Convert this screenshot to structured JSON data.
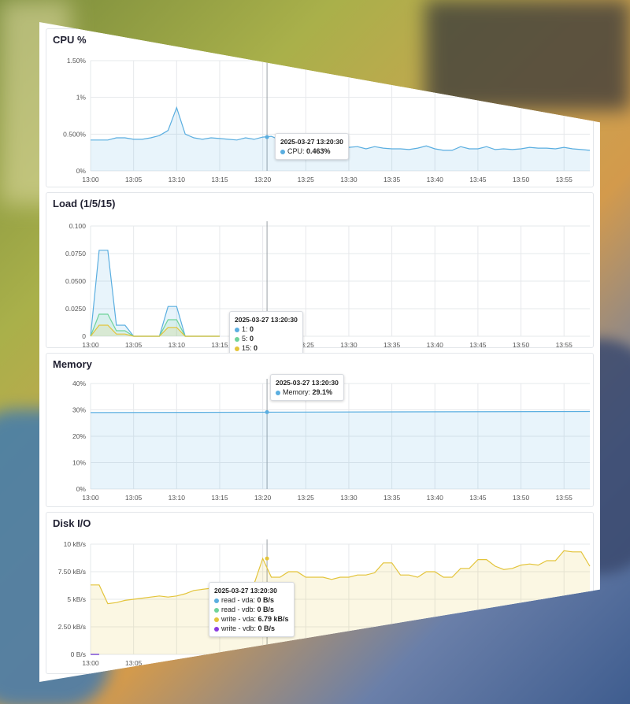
{
  "colors": {
    "cpu": "#5aaee0",
    "cpu_fill": "#dff0fb",
    "load1": "#5aaee0",
    "load5": "#6fd39a",
    "load15": "#e3c43a",
    "memory": "#5aaee0",
    "read_vda": "#5aaee0",
    "read_vdb": "#6fd39a",
    "write_vda": "#e3c43a",
    "write_vdb": "#8a3be0"
  },
  "time_ticks": [
    "13:00",
    "13:05",
    "13:10",
    "13:15",
    "13:20",
    "13:25",
    "13:30",
    "13:35",
    "13:40",
    "13:45",
    "13:50",
    "13:55"
  ],
  "cpu": {
    "title": "CPU %",
    "y_ticks": [
      "1.50%",
      "1%",
      "0.500%",
      "0%"
    ],
    "tooltip": {
      "time": "2025-03-27 13:20:30",
      "label": "CPU:",
      "value": "0.463%"
    }
  },
  "load": {
    "title": "Load (1/5/15)",
    "y_ticks": [
      "0.100",
      "0.0750",
      "0.0500",
      "0.0250",
      "0"
    ],
    "tooltip": {
      "time": "2025-03-27 13:20:30",
      "rows": [
        {
          "label": "1:",
          "value": "0"
        },
        {
          "label": "5:",
          "value": "0"
        },
        {
          "label": "15:",
          "value": "0"
        }
      ]
    }
  },
  "memory": {
    "title": "Memory",
    "y_ticks": [
      "40%",
      "30%",
      "20%",
      "10%",
      "0%"
    ],
    "tooltip": {
      "time": "2025-03-27 13:20:30",
      "label": "Memory:",
      "value": "29.1%"
    }
  },
  "disk": {
    "title": "Disk I/O",
    "y_ticks": [
      "10 kB/s",
      "7.50 kB/s",
      "5 kB/s",
      "2.50 kB/s",
      "0 B/s"
    ],
    "tooltip": {
      "time": "2025-03-27 13:20:30",
      "rows": [
        {
          "label": "read - vda:",
          "value": "0 B/s"
        },
        {
          "label": "read - vdb:",
          "value": "0 B/s"
        },
        {
          "label": "write - vda:",
          "value": "6.79 kB/s"
        },
        {
          "label": "write - vdb:",
          "value": "0 B/s"
        }
      ]
    }
  },
  "chart_data": [
    {
      "type": "area",
      "title": "CPU %",
      "x": [
        "13:00",
        "13:01",
        "13:02",
        "13:03",
        "13:04",
        "13:05",
        "13:06",
        "13:07",
        "13:08",
        "13:09",
        "13:10",
        "13:11",
        "13:12",
        "13:13",
        "13:14",
        "13:15",
        "13:16",
        "13:17",
        "13:18",
        "13:19",
        "13:20",
        "13:21",
        "13:22",
        "13:23",
        "13:24",
        "13:25",
        "13:26",
        "13:27",
        "13:28",
        "13:29",
        "13:30",
        "13:31",
        "13:32",
        "13:33",
        "13:34",
        "13:35",
        "13:36",
        "13:37",
        "13:38",
        "13:39",
        "13:40",
        "13:41",
        "13:42",
        "13:43",
        "13:44",
        "13:45",
        "13:46",
        "13:47",
        "13:48",
        "13:49",
        "13:50",
        "13:51",
        "13:52",
        "13:53",
        "13:54",
        "13:55",
        "13:56",
        "13:57",
        "13:58"
      ],
      "series": [
        {
          "name": "CPU",
          "values": [
            0.42,
            0.42,
            0.42,
            0.45,
            0.45,
            0.43,
            0.43,
            0.45,
            0.48,
            0.55,
            0.86,
            0.5,
            0.45,
            0.43,
            0.45,
            0.44,
            0.43,
            0.42,
            0.45,
            0.43,
            0.46,
            0.47,
            0.42,
            0.36,
            0.38,
            0.4,
            0.38,
            0.36,
            0.35,
            0.33,
            0.32,
            0.33,
            0.3,
            0.33,
            0.31,
            0.3,
            0.3,
            0.29,
            0.31,
            0.34,
            0.3,
            0.28,
            0.28,
            0.33,
            0.3,
            0.3,
            0.33,
            0.29,
            0.3,
            0.29,
            0.3,
            0.32,
            0.31,
            0.31,
            0.3,
            0.32,
            0.3,
            0.29,
            0.28
          ]
        }
      ],
      "ylim": [
        0,
        1.5
      ]
    },
    {
      "type": "area",
      "title": "Load (1/5/15)",
      "x": [
        "13:00",
        "13:01",
        "13:02",
        "13:03",
        "13:04",
        "13:05",
        "13:06",
        "13:07",
        "13:08",
        "13:09",
        "13:10",
        "13:11",
        "13:12",
        "13:13",
        "13:14",
        "13:15"
      ],
      "series": [
        {
          "name": "1",
          "values": [
            0,
            0.078,
            0.078,
            0.01,
            0.01,
            0,
            0,
            0,
            0,
            0.027,
            0.027,
            0,
            0,
            0,
            0,
            0
          ]
        },
        {
          "name": "5",
          "values": [
            0,
            0.02,
            0.02,
            0.005,
            0.005,
            0,
            0,
            0,
            0,
            0.015,
            0.015,
            0,
            0,
            0,
            0,
            0
          ]
        },
        {
          "name": "15",
          "values": [
            0,
            0.01,
            0.01,
            0.002,
            0.002,
            0,
            0,
            0,
            0,
            0.008,
            0.008,
            0,
            0,
            0,
            0,
            0
          ]
        }
      ],
      "ylim": [
        0,
        0.1
      ]
    },
    {
      "type": "area",
      "title": "Memory",
      "x": [
        "13:00",
        "13:58"
      ],
      "series": [
        {
          "name": "Memory",
          "values": [
            29.0,
            29.4
          ]
        }
      ],
      "ylim": [
        0,
        40
      ]
    },
    {
      "type": "area",
      "title": "Disk I/O",
      "x": [
        "13:00",
        "13:01",
        "13:02",
        "13:03",
        "13:04",
        "13:05",
        "13:06",
        "13:07",
        "13:08",
        "13:09",
        "13:10",
        "13:11",
        "13:12",
        "13:13",
        "13:14",
        "13:15",
        "13:16",
        "13:17",
        "13:18",
        "13:19",
        "13:20",
        "13:21",
        "13:22",
        "13:23",
        "13:24",
        "13:25",
        "13:26",
        "13:27",
        "13:28",
        "13:29",
        "13:30",
        "13:31",
        "13:32",
        "13:33",
        "13:34",
        "13:35",
        "13:36",
        "13:37",
        "13:38",
        "13:39",
        "13:40",
        "13:41",
        "13:42",
        "13:43",
        "13:44",
        "13:45",
        "13:46",
        "13:47",
        "13:48",
        "13:49",
        "13:50",
        "13:51",
        "13:52",
        "13:53",
        "13:54",
        "13:55",
        "13:56",
        "13:57",
        "13:58"
      ],
      "series": [
        {
          "name": "write - vda",
          "values": [
            6.3,
            6.3,
            4.6,
            4.7,
            4.9,
            5.0,
            5.1,
            5.2,
            5.3,
            5.2,
            5.3,
            5.5,
            5.8,
            5.9,
            6.0,
            6.1,
            6.2,
            6.3,
            6.4,
            6.4,
            8.7,
            7.0,
            7.0,
            7.5,
            7.5,
            7.0,
            7.0,
            7.0,
            6.8,
            7.0,
            7.0,
            7.2,
            7.2,
            7.4,
            8.3,
            8.3,
            7.2,
            7.2,
            7.0,
            7.5,
            7.5,
            7.0,
            7.0,
            7.8,
            7.8,
            8.6,
            8.6,
            8.0,
            7.7,
            7.8,
            8.1,
            8.2,
            8.1,
            8.5,
            8.5,
            9.4,
            9.3,
            9.3,
            8.0
          ]
        },
        {
          "name": "read - vda",
          "values": [
            0,
            0
          ]
        },
        {
          "name": "read - vdb",
          "values": [
            0,
            0
          ]
        },
        {
          "name": "write - vdb",
          "values": [
            0,
            0
          ]
        }
      ],
      "ylim": [
        0,
        10
      ]
    }
  ]
}
